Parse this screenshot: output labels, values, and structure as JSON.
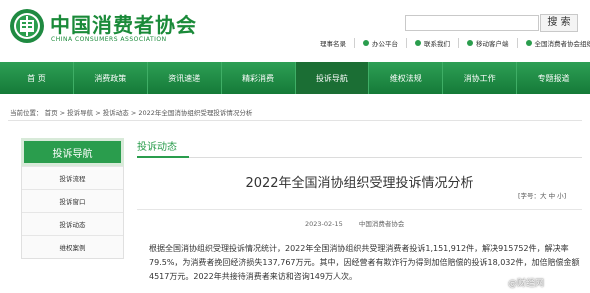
{
  "header": {
    "logo_cn": "中国消费者协会",
    "logo_en": "CHINA CONSUMERS ASSOCIATION",
    "search_button": "搜 索",
    "toplinks": [
      "理事名录",
      "办公平台",
      "联系我们",
      "移动客户端",
      "全国消费者协会组织"
    ]
  },
  "nav": [
    "首  页",
    "消费政策",
    "资讯速递",
    "精彩消费",
    "投诉导航",
    "维权法规",
    "消协工作",
    "专题报道"
  ],
  "breadcrumb": {
    "prefix": "当前位置：",
    "items": [
      "首页",
      "投诉导航",
      "投诉动态",
      "2022年全国消协组织受理投诉情况分析"
    ]
  },
  "sidebar": {
    "title": "投诉导航",
    "items": [
      "投诉流程",
      "投诉窗口",
      "投诉动态",
      "维权案例"
    ]
  },
  "section_tab": "投诉动态",
  "article": {
    "title": "2022年全国消协组织受理投诉情况分析",
    "font_size_label": "[字号：大 中 小]",
    "date": "2023-02-15",
    "source": "中国消费者协会",
    "body": "根据全国消协组织受理投诉情况统计，2022年全国消协组织共受理消费者投诉1,151,912件，解决915752件，解决率79.5%，为消费者挽回经济损失137,767万元。其中，因经营者有欺诈行为得到加倍赔偿的投诉18,032件，加倍赔偿金额4517万元。2022年共接待消费者来访和咨询149万人次。"
  },
  "watermark": "@财经网",
  "colors": {
    "brand_green": "#2a9d4d",
    "nav_green": "#1f8a41"
  }
}
